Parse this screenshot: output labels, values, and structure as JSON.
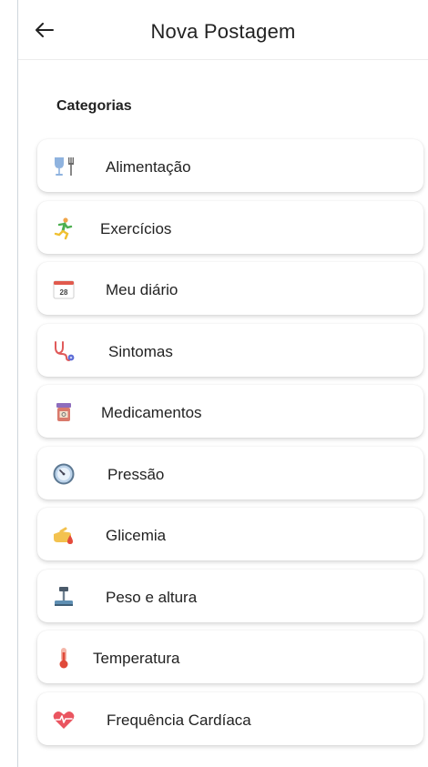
{
  "header": {
    "title": "Nova Postagem",
    "back_icon": "arrow-left-icon"
  },
  "section": {
    "title": "Categorias"
  },
  "categories": [
    {
      "label": "Alimentação",
      "icon": "food-icon"
    },
    {
      "label": "Exercícios",
      "icon": "running-person-icon"
    },
    {
      "label": "Meu diário",
      "icon": "calendar-icon"
    },
    {
      "label": "Sintomas",
      "icon": "stethoscope-icon"
    },
    {
      "label": "Medicamentos",
      "icon": "medicine-bottle-icon"
    },
    {
      "label": "Pressão",
      "icon": "pressure-gauge-icon"
    },
    {
      "label": "Glicemia",
      "icon": "blood-drop-finger-icon"
    },
    {
      "label": "Peso e altura",
      "icon": "scale-icon"
    },
    {
      "label": "Temperatura",
      "icon": "thermometer-icon"
    },
    {
      "label": "Frequência Cardíaca",
      "icon": "heart-rate-icon"
    }
  ],
  "calendar_day": "28"
}
